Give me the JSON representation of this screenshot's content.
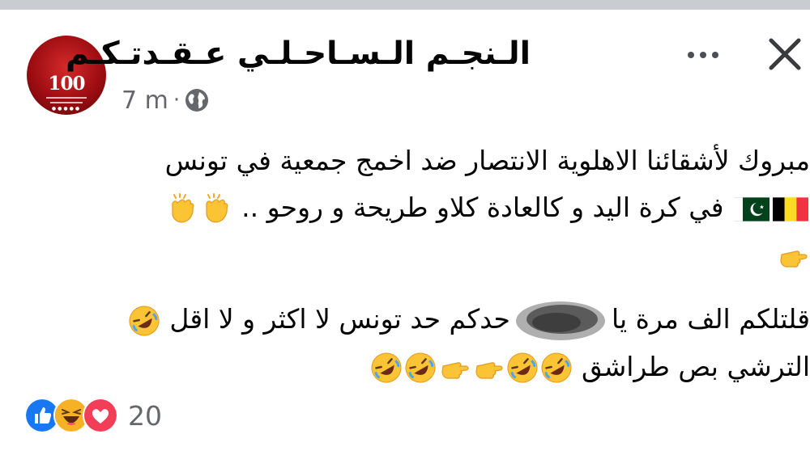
{
  "post": {
    "page_name": "الـنجـم الـسـاحـلـي عـقـدتـكـم",
    "time": "7 m",
    "dot": "·",
    "privacy_icon": "globe-icon",
    "avatar_logo_text": "100",
    "line1": "مبروك لأشقائنا الاهلوية الانتصار ضد اخمج جمعية في تونس",
    "line2": "في كرة اليد و كالعادة كلاو طريحة و روحو ..",
    "line3a": "قلتلكم الف مرة يا",
    "line3b": "حدكم حد تونس لا اكثر و لا اقل",
    "line4": "الترشي بص طراشق"
  },
  "reactions": {
    "count": "20",
    "icons": [
      "like-icon",
      "haha-icon",
      "love-icon"
    ]
  },
  "colors": {
    "text": "#050505",
    "meta": "#65676b",
    "like": "#1877f2",
    "love": "#f33e58",
    "haha": "#f7b125"
  }
}
